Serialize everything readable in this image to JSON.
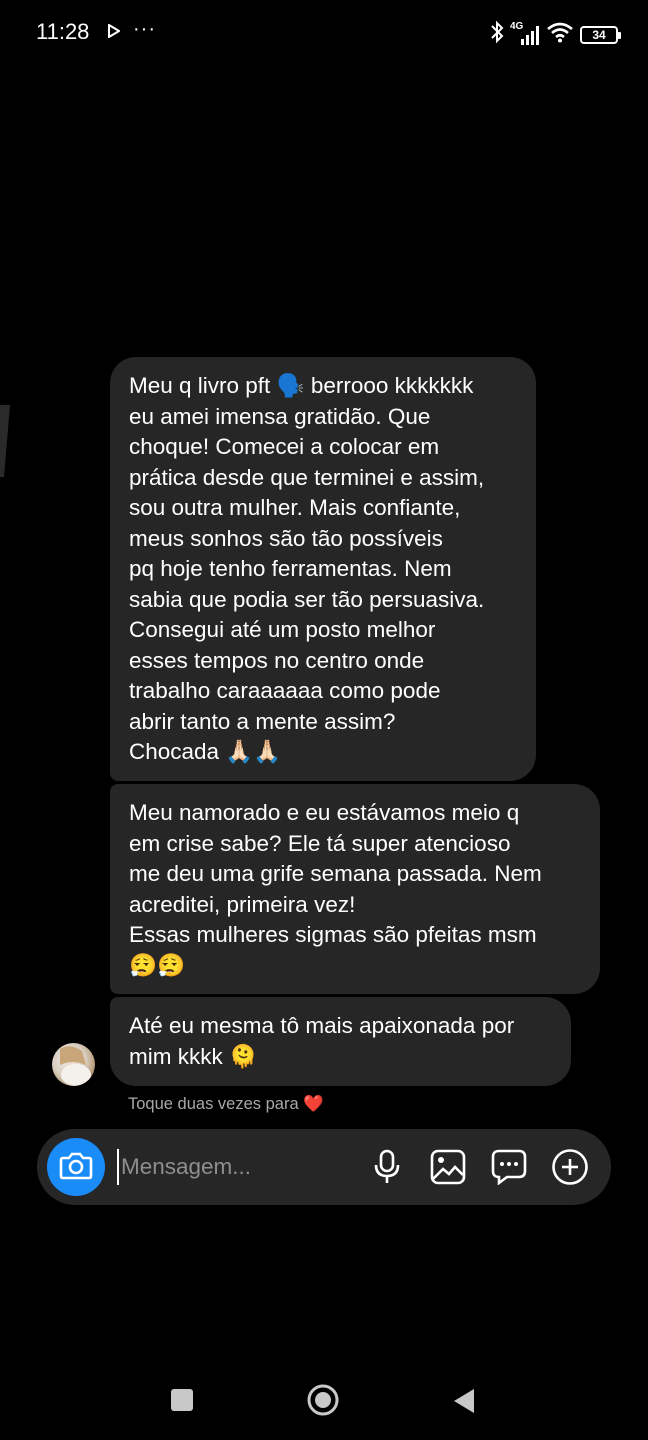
{
  "status": {
    "time": "11:28",
    "more": "···",
    "network": "4G",
    "battery": "34"
  },
  "messages": [
    {
      "text": "Meu q livro pft 🗣️ berrooo kkkkkkk\neu amei imensa gratidão. Que\nchoque! Comecei a colocar em\nprática desde que terminei e assim,\nsou outra mulher. Mais confiante,\nmeus sonhos são tão possíveis\npq hoje tenho ferramentas. Nem\nsabia que podia ser tão persuasiva.\nConsegui até um posto melhor\nesses tempos no centro onde\ntrabalho caraaaaaa como pode\nabrir tanto a mente assim?\nChocada 🙏🏻🙏🏻"
    },
    {
      "text": "Meu namorado e eu estávamos meio q\nem crise sabe? Ele tá super atencioso\nme deu uma grife semana passada. Nem\nacreditei, primeira vez!\nEssas mulheres sigmas são pfeitas msm\n😮‍💨😮‍💨"
    },
    {
      "text": "Até eu mesma tô mais apaixonada por\nmim kkkk 🫠"
    }
  ],
  "hint": "Toque duas vezes para ❤️",
  "composer": {
    "placeholder": "Mensagem..."
  },
  "colors": {
    "background": "#000000",
    "bubble": "#262626",
    "accent": "#1a8cf8",
    "hint": "#a8a8a8"
  },
  "icons": [
    "play-icon",
    "bluetooth-icon",
    "signal-icon",
    "wifi-icon",
    "battery-icon",
    "camera-icon",
    "microphone-icon",
    "gallery-icon",
    "sticker-icon",
    "plus-icon",
    "nav-recents-icon",
    "nav-home-icon",
    "nav-back-icon"
  ]
}
